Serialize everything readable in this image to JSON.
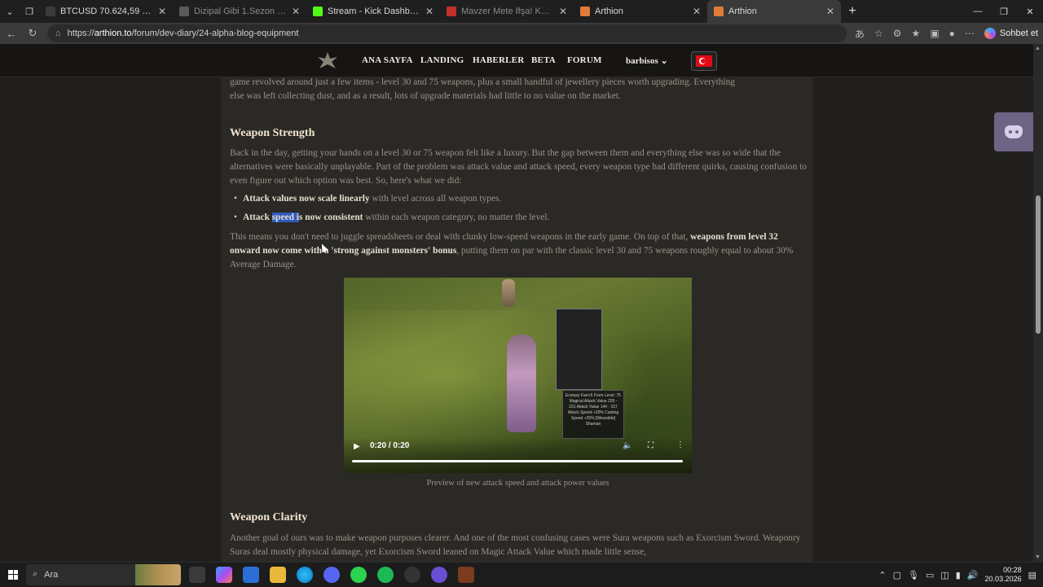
{
  "browser": {
    "tabs": [
      {
        "title": "BTCUSD 70.624,59 ▼ −0.91% Adsız",
        "color": "#3b3b3b",
        "dim": false,
        "active": false
      },
      {
        "title": "Dizipal Gibi 1.Sezon 6.Bölüm izle |",
        "color": "#5a5a5a",
        "dim": true,
        "active": false
      },
      {
        "title": "Stream - Kick Dashboard",
        "color": "#53fc18",
        "dim": false,
        "active": false
      },
      {
        "title": "Mavzer Mete İfşa! Korunmanız Lazım",
        "color": "#c4302b",
        "dim": true,
        "active": false
      },
      {
        "title": "Arthion",
        "color": "#e07b39",
        "dim": false,
        "active": false
      },
      {
        "title": "Arthion",
        "color": "#e07b39",
        "dim": false,
        "active": true
      }
    ],
    "url_prefix": "https://",
    "url_host": "arthion.to",
    "url_path": "/forum/dev-diary/24-alpha-blog-equipment",
    "copilot_label": "Sohbet et"
  },
  "site": {
    "nav": [
      "ANA SAYFA",
      "LANDING",
      "HABERLER",
      "BETA",
      "FORUM"
    ],
    "user": "barbisos"
  },
  "article": {
    "intro_line1": "game revolved around just a few items - level 30 and 75 weapons, plus a small handful of jewellery pieces worth upgrading. Everything",
    "intro_line2": "else was left collecting dust, and as a result, lots of upgrade materials had little to no value on the market.",
    "h_strength": "Weapon Strength",
    "p1": "Back in the day, getting your hands on a level 30 or 75 weapon felt like a luxury. But the gap between them and everything else was so wide that the alternatives were basically unplayable. Part of the problem was attack value and attack speed, every weapon type had different quirks, causing confusion to even figure out which option was best. So, here's what we did:",
    "b1_bold": "Attack values now scale linearly",
    "b1_rest": " with level across all weapon types.",
    "b2_pre": "Attack ",
    "b2_hl": "speed i",
    "b2_bold_rest": "s now consistent",
    "b2_rest": " within each weapon category, no matter the level.",
    "p2_a": "This means you don't need to juggle spreadsheets or deal with clunky low-speed weapons in the early game. On top of that, ",
    "p2_bold": "weapons from level 32 onward now come with a 'strong against monsters' bonus",
    "p2_b": ", putting them on par with the classic level 30 and 75 weapons roughly equal to about 30% Average Damage.",
    "video_time": "0:20 / 0:20",
    "video_tooltip": "Ecstasy Fan+5 From Level: 75 Magical Attack Value 205 - 231 Attack Value 144 - 157 Attack Speed +20% Casting Speed +25% [Wearable] Shaman",
    "caption": "Preview of new attack speed and attack power values",
    "h_clarity": "Weapon Clarity",
    "p3": "Another goal of ours was to make weapon purposes clearer. And one of the most confusing cases were Sura weapons such as Exorcism Sword. Weaponry Suras deal mostly physical damage, yet Exorcism Sword leaned on Magic Attack Value which made little sense,"
  },
  "taskbar": {
    "search_label": "Ara",
    "time": "00:28",
    "date": "20.03.2026"
  }
}
